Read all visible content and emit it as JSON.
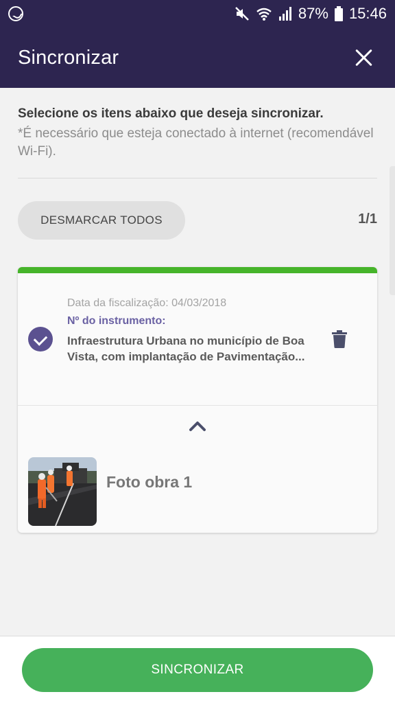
{
  "status_bar": {
    "battery": "87%",
    "time": "15:46",
    "icons": [
      "whatsapp-icon",
      "mute-icon",
      "wifi-icon",
      "signal-icon",
      "battery-icon"
    ]
  },
  "app_bar": {
    "title": "Sincronizar",
    "close_icon": "close-icon",
    "background": "#2d2550"
  },
  "instructions": {
    "title": "Selecione os itens abaixo que deseja sincronizar.",
    "note": "*É necessário que esteja conectado à internet (recomendável Wi-Fi)."
  },
  "selection": {
    "unselect_all_label": "DESMARCAR TODOS",
    "counter": "1/1"
  },
  "items": [
    {
      "checked": true,
      "date_line": "Data da fiscalização: 04/03/2018",
      "instrument_label": "Nº do instrumento:",
      "description": "Infraestrutura Urbana no município de Boa Vista, com implantação de Pavimentação...",
      "accent_color": "#46b42a",
      "photos": [
        {
          "label": "Foto obra 1"
        }
      ]
    }
  ],
  "footer": {
    "sync_label": "SINCRONIZAR",
    "button_color": "#46b15a"
  }
}
